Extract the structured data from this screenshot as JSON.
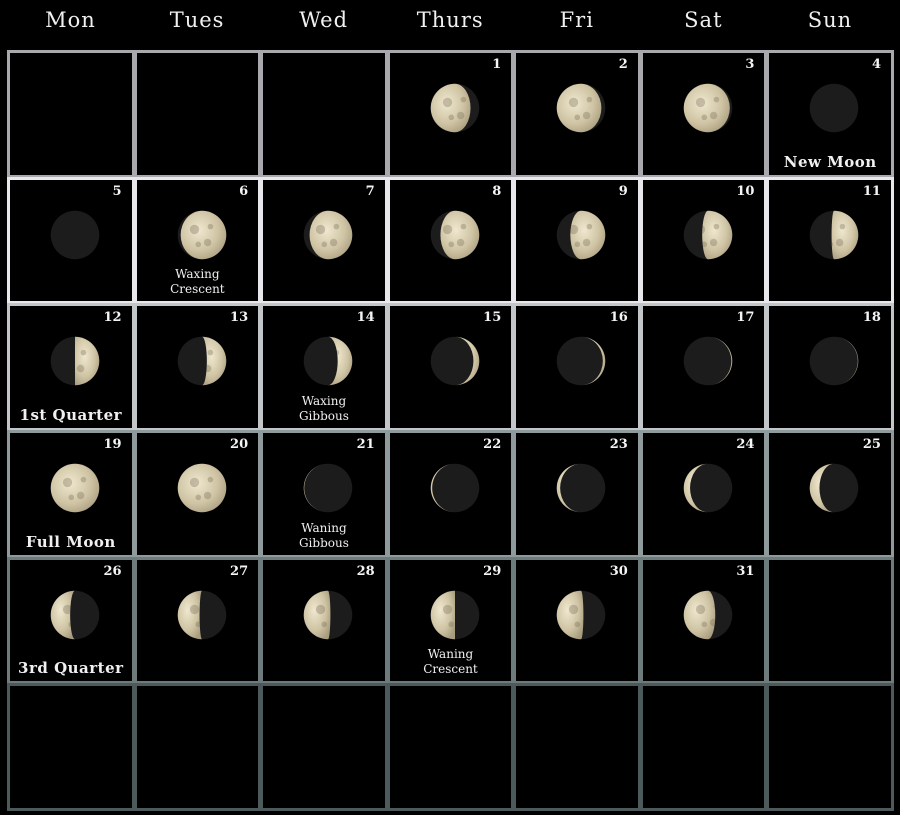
{
  "calendar": {
    "weekdays": [
      "Mon",
      "Tues",
      "Wed",
      "Thurs",
      "Fri",
      "Sat",
      "Sun"
    ],
    "first_weekday_index": 3,
    "rows": 6,
    "row_border_colors": [
      "#a9a9ad",
      "#e8e8ec",
      "#c2c6c8",
      "#8e9a9b",
      "#6e7b7c",
      "#4d5a5b"
    ],
    "colors": {
      "lit": "#d9cfb2",
      "dark": "#1c1c1c",
      "background": "#000000",
      "text": "#f2f2f2"
    },
    "days": [
      {
        "day": "1",
        "phase": 0.18,
        "dir": "left"
      },
      {
        "day": "2",
        "phase": 0.08,
        "dir": "left"
      },
      {
        "day": "3",
        "phase": 0.05,
        "dir": "left"
      },
      {
        "day": "4",
        "phase": 0.0,
        "dir": "none",
        "label": "New Moon",
        "big": true
      },
      {
        "day": "5",
        "phase": 0.0,
        "dir": "none"
      },
      {
        "day": "6",
        "phase": 0.06,
        "dir": "right",
        "label": "Waxing Crescent"
      },
      {
        "day": "7",
        "phase": 0.12,
        "dir": "right"
      },
      {
        "day": "8",
        "phase": 0.2,
        "dir": "right"
      },
      {
        "day": "9",
        "phase": 0.28,
        "dir": "right"
      },
      {
        "day": "10",
        "phase": 0.38,
        "dir": "right"
      },
      {
        "day": "11",
        "phase": 0.45,
        "dir": "right"
      },
      {
        "day": "12",
        "phase": 0.5,
        "dir": "right",
        "label": "1st Quarter",
        "big": true
      },
      {
        "day": "13",
        "phase": 0.6,
        "dir": "right"
      },
      {
        "day": "14",
        "phase": 0.7,
        "dir": "right",
        "label": "Waxing Gibbous"
      },
      {
        "day": "15",
        "phase": 0.88,
        "dir": "right"
      },
      {
        "day": "16",
        "phase": 0.95,
        "dir": "right"
      },
      {
        "day": "17",
        "phase": 0.98,
        "dir": "right"
      },
      {
        "day": "18",
        "phase": 0.99,
        "dir": "right"
      },
      {
        "day": "19",
        "phase": 1.0,
        "dir": "none",
        "label": "Full Moon",
        "big": true
      },
      {
        "day": "20",
        "phase": 1.0,
        "dir": "none"
      },
      {
        "day": "21",
        "phase": 0.99,
        "dir": "left",
        "label": "Waning Gibbous"
      },
      {
        "day": "22",
        "phase": 0.97,
        "dir": "left"
      },
      {
        "day": "23",
        "phase": 0.93,
        "dir": "left"
      },
      {
        "day": "24",
        "phase": 0.87,
        "dir": "left"
      },
      {
        "day": "25",
        "phase": 0.8,
        "dir": "left"
      },
      {
        "day": "26",
        "phase": 0.6,
        "dir": "left",
        "label": "3rd Quarter",
        "big": true
      },
      {
        "day": "27",
        "phase": 0.55,
        "dir": "left"
      },
      {
        "day": "28",
        "phase": 0.45,
        "dir": "left"
      },
      {
        "day": "29",
        "phase": 0.5,
        "dir": "left",
        "label": "Waning Crescent"
      },
      {
        "day": "30",
        "phase": 0.45,
        "dir": "left"
      },
      {
        "day": "31",
        "phase": 0.35,
        "dir": "left"
      }
    ]
  }
}
